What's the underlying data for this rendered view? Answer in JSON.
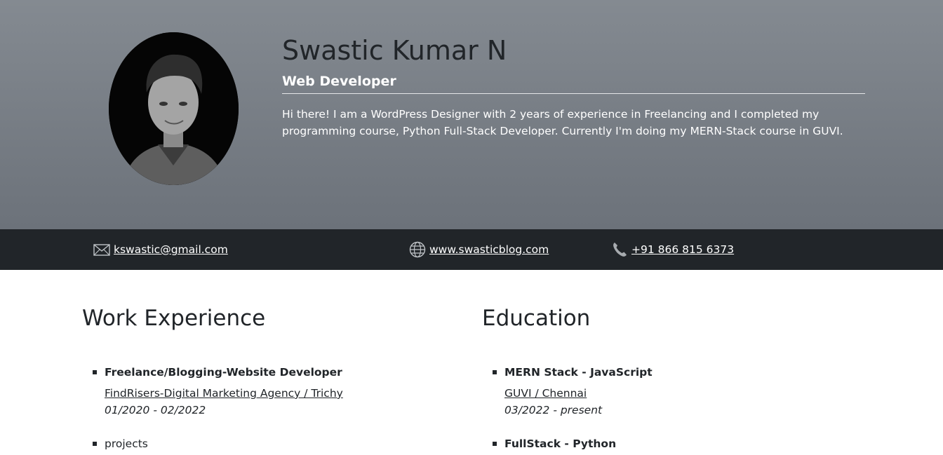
{
  "profile": {
    "name": "Swastic Kumar N",
    "role": "Web Developer",
    "bio": "Hi there! I am a WordPress Designer with 2 years of experience in Freelancing and I completed my programming course, Python Full-Stack Developer. Currently I'm doing my MERN-Stack course in GUVI."
  },
  "contact": {
    "email": "kswastic@gmail.com",
    "website": "www.swasticblog.com",
    "phone": "+91 866 815 6373",
    "email_icon": "envelope-icon",
    "website_icon": "globe-icon",
    "phone_icon": "phone-icon"
  },
  "work": {
    "title": "Work Experience",
    "items": [
      {
        "title": "Freelance/Blogging-Website Developer",
        "place": "FindRisers-Digital Marketing Agency / Trichy",
        "dates": "01/2020 - 02/2022"
      },
      {
        "title": "projects"
      }
    ]
  },
  "education": {
    "title": "Education",
    "items": [
      {
        "title": "MERN Stack - JavaScript",
        "place": "GUVI / Chennai",
        "dates": "03/2022 - present"
      },
      {
        "title": "FullStack - Python"
      }
    ]
  },
  "colors": {
    "hero_top": "#848a91",
    "hero_bottom": "#6c727a",
    "contact_bar": "#212529",
    "text_dark": "#212529"
  }
}
